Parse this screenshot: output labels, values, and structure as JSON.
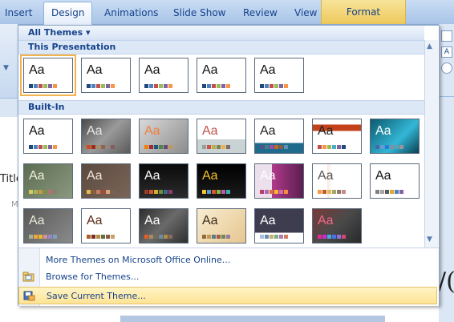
{
  "ribbon": {
    "tabs": [
      "Insert",
      "Design",
      "Animations",
      "Slide Show",
      "Review",
      "View"
    ],
    "format_tab": "Format"
  },
  "backdrop": {
    "title_fragment": "Title",
    "m_fragment": "M",
    "big_text": "/(",
    "right_icons": [
      "A",
      "○"
    ]
  },
  "gallery": {
    "all_themes": "All Themes",
    "this_presentation": "This Presentation",
    "built_in": "Built-In",
    "aa_text": "Aa",
    "presentation_themes": [
      {
        "bg": "#ffffff",
        "fg": "#111111",
        "sw": [
          "#1f497d",
          "#4f81bd",
          "#c0504d",
          "#9bbb59",
          "#8064a2",
          "#f79646"
        ]
      },
      {
        "bg": "#ffffff",
        "fg": "#111111",
        "sw": [
          "#1f497d",
          "#4f81bd",
          "#c0504d",
          "#9bbb59",
          "#8064a2",
          "#f79646"
        ]
      },
      {
        "bg": "#ffffff",
        "fg": "#111111",
        "sw": [
          "#1f497d",
          "#4f81bd",
          "#c0504d",
          "#9bbb59",
          "#8064a2",
          "#f79646"
        ]
      },
      {
        "bg": "#ffffff",
        "fg": "#111111",
        "sw": [
          "#1f497d",
          "#4f81bd",
          "#c0504d",
          "#9bbb59",
          "#8064a2",
          "#f79646"
        ]
      },
      {
        "bg": "#ffffff",
        "fg": "#111111",
        "sw": [
          "#1f497d",
          "#4f81bd",
          "#c0504d",
          "#9bbb59",
          "#8064a2",
          "#f79646"
        ]
      }
    ],
    "builtin_rows": [
      [
        {
          "bg": "#ffffff",
          "fg": "#111111",
          "sw": [
            "#1f497d",
            "#4f81bd",
            "#c0504d",
            "#9bbb59",
            "#8064a2",
            "#f79646"
          ]
        },
        {
          "bg": "linear-gradient(135deg,#4a4a4a,#9a9a9a 50%,#5a5a5a)",
          "fg": "#e8e8e8",
          "sw": [
            "#d34817",
            "#9b2d1f",
            "#a28e6a",
            "#956251",
            "#918485",
            "#855d5d"
          ]
        },
        {
          "bg": "linear-gradient(135deg,#d9d9d9,#8c8c8c)",
          "fg": "#f07f3c",
          "sw": [
            "#f07f09",
            "#9f2936",
            "#1b587c",
            "#4e8542",
            "#604878",
            "#c19859"
          ]
        },
        {
          "bg": "linear-gradient(#ffffff 60%,#c9d3d3 60%)",
          "fg": "#c0504d",
          "sw": [
            "#93a299",
            "#cf543f",
            "#b5ae53",
            "#848058",
            "#e8b54d",
            "#786c71"
          ]
        },
        {
          "bg": "linear-gradient(#ffffff 70%,#1e6b8e 70%)",
          "fg": "#222222",
          "sw": [
            "#53548a",
            "#438086",
            "#a04da3",
            "#c4652d",
            "#8b5d3d",
            "#5c92b5"
          ]
        },
        {
          "bg": "linear-gradient(#ffffff 15%,#c3421c 15%,#c3421c 35%,#ffffff 35%)",
          "fg": "#222222",
          "sw": [
            "#c0504d",
            "#f79646",
            "#9bbb59",
            "#4bacc6",
            "#8064a2",
            "#1f497d"
          ]
        },
        {
          "bg": "linear-gradient(135deg,#0d5a6e,#33b7d6 60%,#0a4050)",
          "fg": "#ffffff",
          "sw": [
            "#4a66ac",
            "#629dd1",
            "#297fd5",
            "#7f8fa9",
            "#5aa2ae",
            "#9d90a0"
          ]
        }
      ],
      [
        {
          "bg": "linear-gradient(135deg,#5b6d50,#8b9880)",
          "fg": "#f2efd9",
          "sw": [
            "#d4c95d",
            "#a7b25c",
            "#c49a3a",
            "#7f8e4a",
            "#b0746f",
            "#8b7d6b"
          ]
        },
        {
          "bg": "linear-gradient(135deg,#5b4a3e,#7a6458)",
          "fg": "#f0e6dc",
          "sw": [
            "#e1bd4b",
            "#8a5e3c",
            "#c4805e",
            "#a24c3d",
            "#d9a678",
            "#7d5e56"
          ]
        },
        {
          "bg": "linear-gradient(#0a0a0a,#2b2b2b)",
          "fg": "#ffffff",
          "sw": [
            "#9c3a2c",
            "#d05a2c",
            "#e3a92e",
            "#6b8f3a",
            "#3a6b8f",
            "#8f3a6b"
          ]
        },
        {
          "bg": "linear-gradient(#000000,#1b1b1b)",
          "fg": "#f7c32a",
          "sw": [
            "#f7c32a",
            "#4fa0d8",
            "#e2542e",
            "#8dbb3c",
            "#be5bae",
            "#3cafb5"
          ]
        },
        {
          "bg": "linear-gradient(90deg,#ece0ec 35%,#b03a8b 35%,#5b1e4e)",
          "fg": "#ffffff",
          "sw": [
            "#b83d68",
            "#ac66bb",
            "#de6c36",
            "#f9b639",
            "#cf6da4",
            "#fa8d3d"
          ]
        },
        {
          "bg": "linear-gradient(90deg,#ffffff 30%,#f7e8e0 30%,#ffffff 40%)",
          "fg": "#555555",
          "sw": [
            "#f39c46",
            "#c55b2d",
            "#e2b94c",
            "#a5a56c",
            "#8c7a6a",
            "#c58c8c"
          ]
        },
        {
          "bg": "#ffffff",
          "fg": "#111111",
          "sw": [
            "#7f7f7f",
            "#a5a5a5",
            "#595959",
            "#e0a92c",
            "#4f81bd",
            "#8064a2"
          ]
        }
      ],
      [
        {
          "bg": "linear-gradient(135deg,#595959,#8a8a8a)",
          "fg": "#e8e8d8",
          "sw": [
            "#a5b592",
            "#f3a447",
            "#e7bc29",
            "#d092a7",
            "#9c85c0",
            "#809ec2"
          ]
        },
        {
          "bg": "#ffffff",
          "fg": "#5b2b1a",
          "sw": [
            "#aa6128",
            "#7c2c21",
            "#b28c46",
            "#5f6d3a",
            "#8f5a44",
            "#c4a06a"
          ]
        },
        {
          "bg": "linear-gradient(135deg,#2e2e2e,#6a6a6a 50%,#2e2e2e)",
          "fg": "#ffffff",
          "sw": [
            "#ea5d22",
            "#a28e6a",
            "#756b5b",
            "#6a8fa3",
            "#b58a4a",
            "#8b6b5b"
          ]
        },
        {
          "bg": "linear-gradient(135deg,#f8ecd0,#e6c791)",
          "fg": "#3a2a1a",
          "sw": [
            "#8b6d3c",
            "#c09a55",
            "#5b7b8b",
            "#a35b4b",
            "#6b8b5b",
            "#9b7b9b"
          ]
        },
        {
          "bg": "linear-gradient(#3d3d4f 70%,#ffffff 70%)",
          "fg": "#ffffff",
          "sw": [
            "#a8c0e0",
            "#6a8db8",
            "#c8b070",
            "#7db07d",
            "#b07db0",
            "#d08060"
          ]
        },
        {
          "bg": "linear-gradient(135deg,#7a3a3a,#4a4a4a 50%,#2a2a2a)",
          "fg": "#f06a8a",
          "sw": [
            "#e32d91",
            "#c830cc",
            "#4ea6dc",
            "#4775e7",
            "#8971e1",
            "#d54773"
          ]
        }
      ]
    ],
    "menu": [
      {
        "label": "More Themes on Microsoft Office Online..."
      },
      {
        "label": "Browse for Themes..."
      },
      {
        "label": "Save Current Theme..."
      }
    ]
  }
}
